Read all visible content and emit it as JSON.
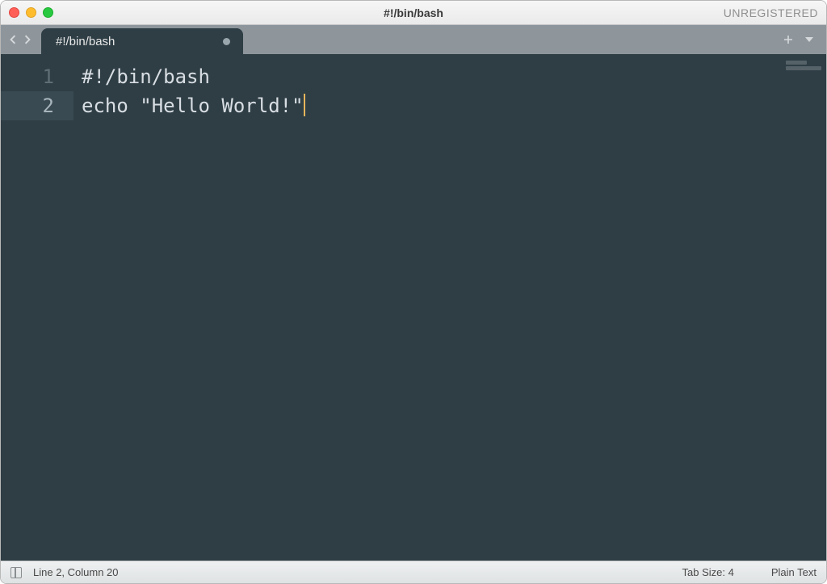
{
  "titlebar": {
    "title": "#!/bin/bash",
    "unregistered_label": "UNREGISTERED"
  },
  "tabs": [
    {
      "label": "#!/bin/bash",
      "dirty": true
    }
  ],
  "code": {
    "lines": [
      "#!/bin/bash",
      "echo \"Hello World!\""
    ],
    "cursor_line": 2,
    "active_line": 2
  },
  "gutter": {
    "numbers": [
      "1",
      "2"
    ]
  },
  "statusbar": {
    "position": "Line 2, Column 20",
    "tab_size": "Tab Size: 4",
    "syntax": "Plain Text"
  }
}
